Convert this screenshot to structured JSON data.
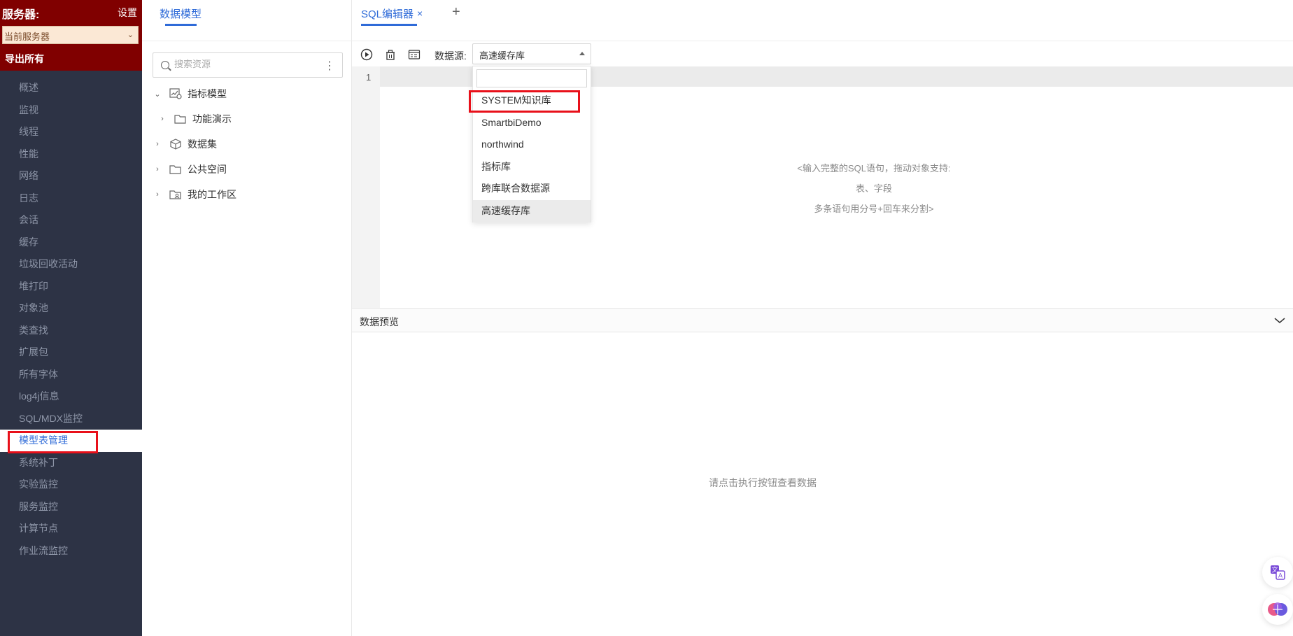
{
  "sidebar": {
    "title": "服务器:",
    "settings": "设置",
    "server_select": "当前服务器",
    "export_all": "导出所有",
    "menu": [
      {
        "label": "概述"
      },
      {
        "label": "监视"
      },
      {
        "label": "线程"
      },
      {
        "label": "性能"
      },
      {
        "label": "网络"
      },
      {
        "label": "日志"
      },
      {
        "label": "会话"
      },
      {
        "label": "缓存"
      },
      {
        "label": "垃圾回收活动"
      },
      {
        "label": "堆打印"
      },
      {
        "label": "对象池"
      },
      {
        "label": "类查找"
      },
      {
        "label": "扩展包"
      },
      {
        "label": "所有字体"
      },
      {
        "label": "log4j信息"
      },
      {
        "label": "SQL/MDX监控"
      },
      {
        "label": "模型表管理",
        "active": true
      },
      {
        "label": "系统补丁"
      },
      {
        "label": "实验监控"
      },
      {
        "label": "服务监控"
      },
      {
        "label": "计算节点"
      },
      {
        "label": "作业流监控"
      }
    ]
  },
  "model_panel": {
    "tab": "数据模型",
    "search_placeholder": "搜索资源",
    "tree": [
      {
        "label": "指标模型",
        "icon": "chart-model-icon",
        "expanded": true
      },
      {
        "label": "功能演示",
        "icon": "folder-icon",
        "child": true
      },
      {
        "label": "数据集",
        "icon": "cube-icon"
      },
      {
        "label": "公共空间",
        "icon": "folder-icon"
      },
      {
        "label": "我的工作区",
        "icon": "workspace-folder-icon"
      }
    ]
  },
  "editor": {
    "tab": "SQL编辑器",
    "datasource_label": "数据源:",
    "datasource_selected": "高速缓存库",
    "line_number": "1",
    "hint_lines": [
      "<输入完整的SQL语句，拖动对象支持:",
      "表、字段",
      "多条语句用分号+回车来分割>"
    ],
    "preview_title": "数据预览",
    "preview_empty": "请点击执行按钮查看数据"
  },
  "datasource_dropdown": {
    "options": [
      {
        "label": "SYSTEM知识库",
        "highlighted": true
      },
      {
        "label": "SmartbiDemo"
      },
      {
        "label": "northwind"
      },
      {
        "label": "指标库"
      },
      {
        "label": "跨库联合数据源"
      },
      {
        "label": "高速缓存库",
        "selected": true
      }
    ]
  },
  "colors": {
    "brand_red": "#800000",
    "accent_blue": "#2f6bd8",
    "sidebar_bg": "#2d3345",
    "highlight_red": "#e8101a"
  }
}
